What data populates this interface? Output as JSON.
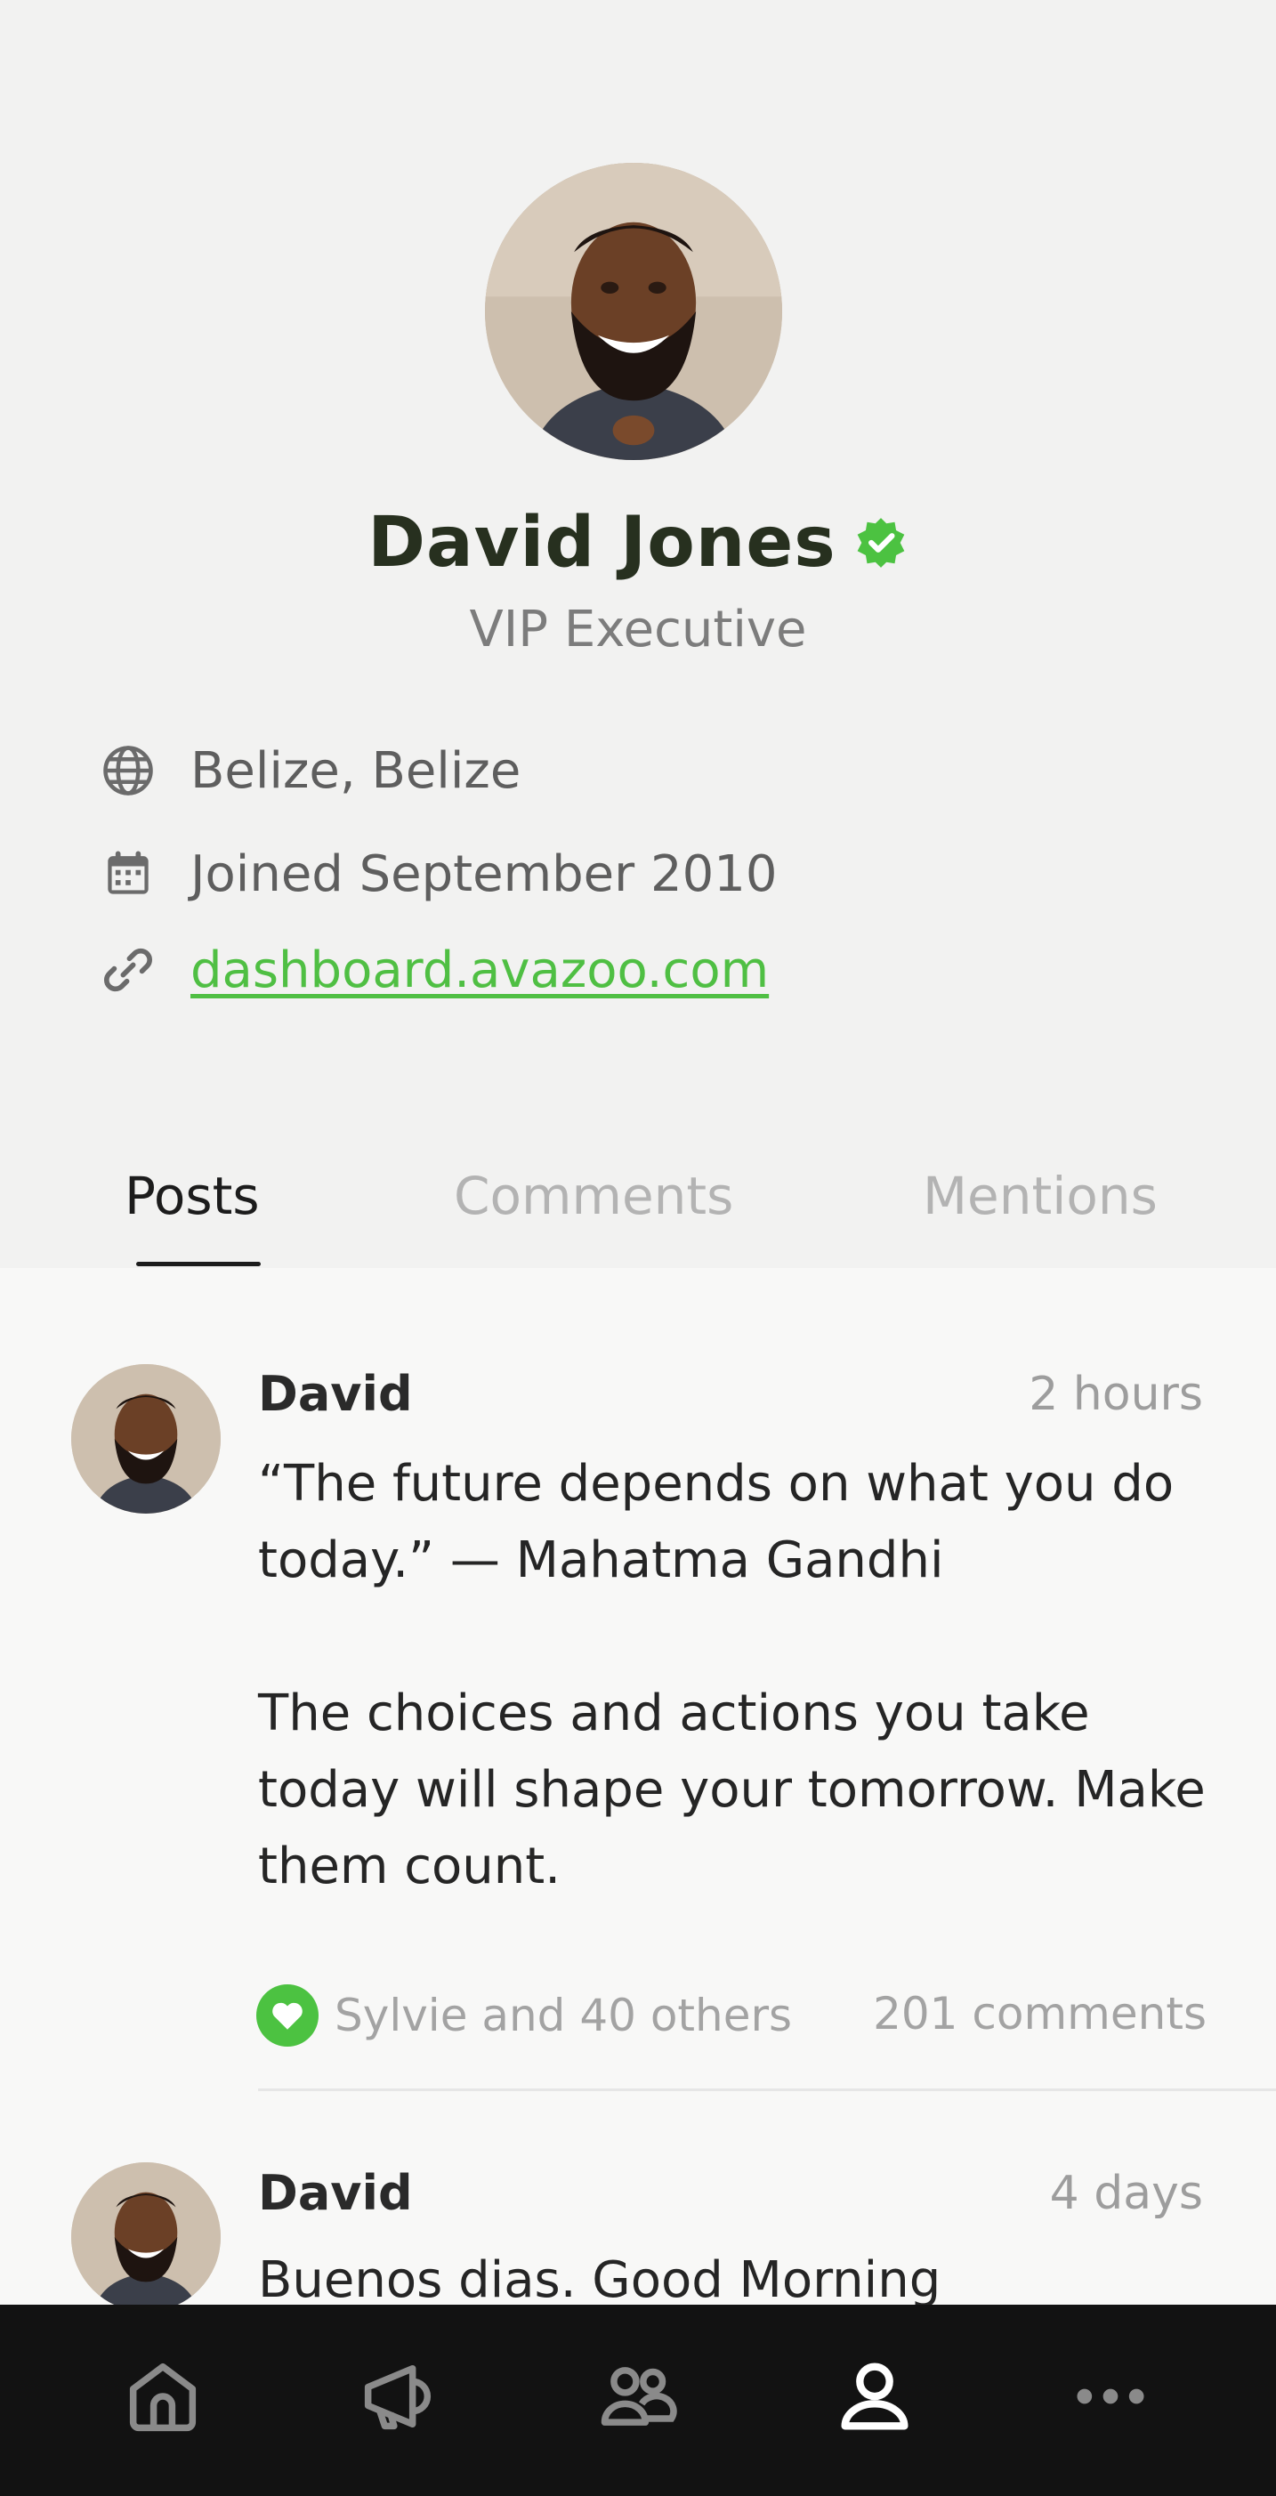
{
  "profile": {
    "name": "David Jones",
    "title": "VIP Executive",
    "location": "Belize, Belize",
    "joined": "Joined September 2010",
    "website": "dashboard.avazoo.com",
    "verified_color": "#4cc241"
  },
  "tabs": [
    {
      "label": "Posts",
      "active": true
    },
    {
      "label": "Comments",
      "active": false
    },
    {
      "label": "Mentions",
      "active": false
    }
  ],
  "posts": [
    {
      "author": "David",
      "time": "2 hours",
      "body": "“The future depends on what you do today.” — Mahatma Gandhi\n\nThe choices and actions you take today will shape your tomorrow. Make them count.",
      "likes": "Sylvie and 40 others",
      "comments": "201 comments"
    },
    {
      "author": "David",
      "time": "4 days",
      "body": "Buenos dias. Good Morning"
    }
  ],
  "nav": {
    "items": [
      "home-icon",
      "megaphone-icon",
      "community-icon",
      "profile-icon",
      "more-icon"
    ],
    "active": "profile-icon"
  },
  "colors": {
    "accent": "#4fbf43",
    "nav_bg": "#121212"
  }
}
